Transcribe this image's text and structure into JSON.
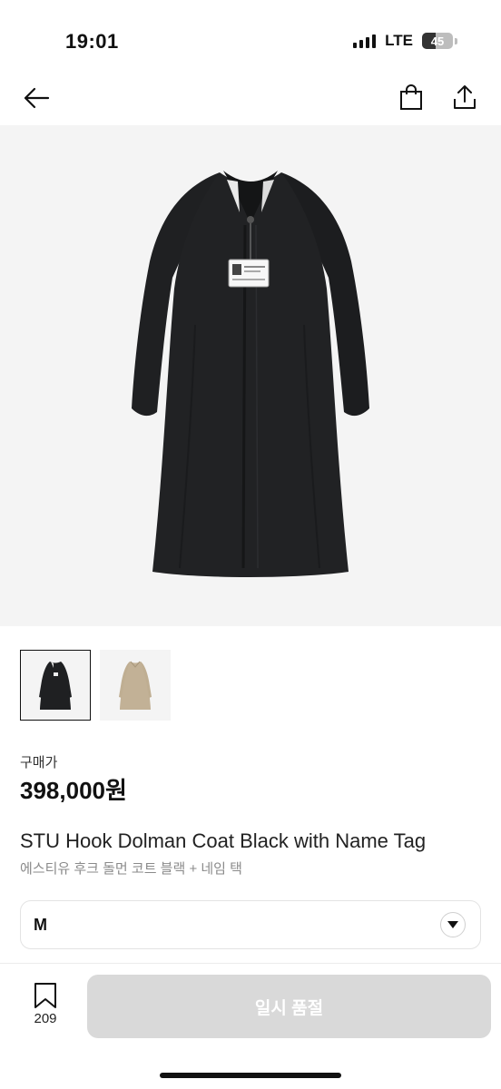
{
  "status_bar": {
    "time": "19:01",
    "network": "LTE",
    "battery": "45",
    "battery_level_percent": 45
  },
  "nav": {
    "back_icon": "arrow-left-icon",
    "bag_icon": "shopping-bag-icon",
    "share_icon": "share-icon"
  },
  "product": {
    "price_label": "구매가",
    "price": "398,000원",
    "name_en": "STU Hook Dolman Coat Black with Name Tag",
    "name_ko": "에스티유 후크 돌먼 코트 블랙 + 네임 택",
    "thumbnails": [
      {
        "color": "#1f2022",
        "selected": true
      },
      {
        "color": "#c2b196",
        "selected": false
      }
    ]
  },
  "size_select": {
    "value": "M",
    "icon": "chevron-down-icon"
  },
  "bottom_bar": {
    "bookmark_icon": "bookmark-icon",
    "bookmark_count": "209",
    "cta_label": "일시 품절"
  },
  "colors": {
    "cta_disabled": "#d9d9d9",
    "hero_bg": "#f4f4f4",
    "coat_black": "#1f2022",
    "coat_beige": "#c2b196"
  }
}
